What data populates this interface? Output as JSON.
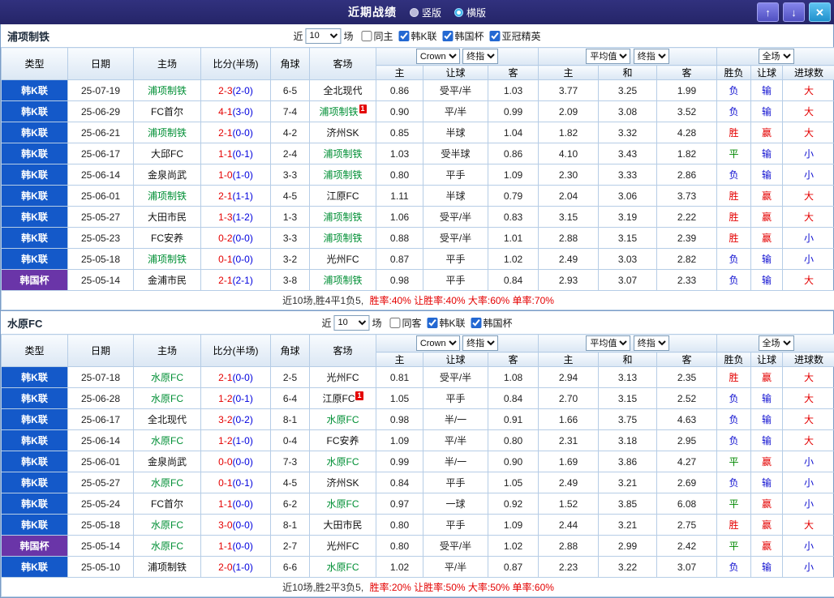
{
  "topbar": {
    "title": "近期战绩",
    "layout_options": [
      {
        "label": "竖版",
        "selected": false
      },
      {
        "label": "横版",
        "selected": true
      }
    ],
    "up_icon": "↑",
    "down_icon": "↓",
    "close_icon": "✕"
  },
  "colors": {
    "topbar_bg1": "#31317e",
    "topbar_bg2": "#252568",
    "up_btn1": "#8585ea",
    "up_btn2": "#5050c2",
    "close_btn1": "#5ec4f2",
    "close_btn2": "#2090cc",
    "header_bg1": "#f8fbfe",
    "header_bg2": "#dbe7f4",
    "border_outer": "#7a9cc6",
    "border_inner": "#b6cde6",
    "league_blue": "#1459c9",
    "cup_purple": "#6a35a8",
    "team_green": "#008f35",
    "score_red": "#e40000",
    "score_half_blue": "#0000dd",
    "win_red": "#e40000",
    "lose_blue": "#0f0fd0",
    "draw_green": "#008800",
    "summary_red": "#e40000"
  },
  "tables": [
    {
      "team": "浦项制铁",
      "filter": {
        "prefix": "近",
        "count": "10",
        "suffix": "场",
        "checkboxes": [
          {
            "label": "同主",
            "checked": false
          },
          {
            "label": "韩K联",
            "checked": true
          },
          {
            "label": "韩国杯",
            "checked": true
          },
          {
            "label": "亚冠精英",
            "checked": true
          }
        ]
      },
      "header": {
        "cols": [
          "类型",
          "日期",
          "主场",
          "比分(半场)",
          "角球",
          "客场"
        ],
        "selects": [
          "Crown",
          "终指",
          "平均值",
          "终指",
          "全场"
        ],
        "sub": [
          "主",
          "让球",
          "客",
          "主",
          "和",
          "客",
          "胜负",
          "让球",
          "进球数"
        ]
      },
      "rows": [
        {
          "type": "韩K联",
          "type_style": "kleague",
          "date": "25-07-19",
          "home": "浦项制铁",
          "home_focus": true,
          "home_badge": "",
          "score_full": "2-3",
          "score_half": "(2-0)",
          "corner": "6-5",
          "away": "全北现代",
          "away_focus": false,
          "away_badge": "",
          "odds_home": "0.86",
          "handicap": "受平/半",
          "odds_away": "1.03",
          "avg_home": "3.77",
          "avg_draw": "3.25",
          "avg_away": "1.99",
          "result": "负",
          "handicap_result": "输",
          "goals_result": "大"
        },
        {
          "type": "韩K联",
          "type_style": "kleague",
          "date": "25-06-29",
          "home": "FC首尔",
          "home_focus": false,
          "home_badge": "",
          "score_full": "4-1",
          "score_half": "(3-0)",
          "corner": "7-4",
          "away": "浦项制铁",
          "away_focus": true,
          "away_badge": "1",
          "odds_home": "0.90",
          "handicap": "平/半",
          "odds_away": "0.99",
          "avg_home": "2.09",
          "avg_draw": "3.08",
          "avg_away": "3.52",
          "result": "负",
          "handicap_result": "输",
          "goals_result": "大"
        },
        {
          "type": "韩K联",
          "type_style": "kleague",
          "date": "25-06-21",
          "home": "浦项制铁",
          "home_focus": true,
          "home_badge": "",
          "score_full": "2-1",
          "score_half": "(0-0)",
          "corner": "4-2",
          "away": "济州SK",
          "away_focus": false,
          "away_badge": "",
          "odds_home": "0.85",
          "handicap": "半球",
          "odds_away": "1.04",
          "avg_home": "1.82",
          "avg_draw": "3.32",
          "avg_away": "4.28",
          "result": "胜",
          "handicap_result": "赢",
          "goals_result": "大"
        },
        {
          "type": "韩K联",
          "type_style": "kleague",
          "date": "25-06-17",
          "home": "大邱FC",
          "home_focus": false,
          "home_badge": "",
          "score_full": "1-1",
          "score_half": "(0-1)",
          "corner": "2-4",
          "away": "浦项制铁",
          "away_focus": true,
          "away_badge": "",
          "odds_home": "1.03",
          "handicap": "受半球",
          "odds_away": "0.86",
          "avg_home": "4.10",
          "avg_draw": "3.43",
          "avg_away": "1.82",
          "result": "平",
          "handicap_result": "输",
          "goals_result": "小"
        },
        {
          "type": "韩K联",
          "type_style": "kleague",
          "date": "25-06-14",
          "home": "金泉尚武",
          "home_focus": false,
          "home_badge": "",
          "score_full": "1-0",
          "score_half": "(1-0)",
          "corner": "3-3",
          "away": "浦项制铁",
          "away_focus": true,
          "away_badge": "",
          "odds_home": "0.80",
          "handicap": "平手",
          "odds_away": "1.09",
          "avg_home": "2.30",
          "avg_draw": "3.33",
          "avg_away": "2.86",
          "result": "负",
          "handicap_result": "输",
          "goals_result": "小"
        },
        {
          "type": "韩K联",
          "type_style": "kleague",
          "date": "25-06-01",
          "home": "浦项制铁",
          "home_focus": true,
          "home_badge": "",
          "score_full": "2-1",
          "score_half": "(1-1)",
          "corner": "4-5",
          "away": "江原FC",
          "away_focus": false,
          "away_badge": "",
          "odds_home": "1.11",
          "handicap": "半球",
          "odds_away": "0.79",
          "avg_home": "2.04",
          "avg_draw": "3.06",
          "avg_away": "3.73",
          "result": "胜",
          "handicap_result": "赢",
          "goals_result": "大"
        },
        {
          "type": "韩K联",
          "type_style": "kleague",
          "date": "25-05-27",
          "home": "大田市民",
          "home_focus": false,
          "home_badge": "",
          "score_full": "1-3",
          "score_half": "(1-2)",
          "corner": "1-3",
          "away": "浦项制铁",
          "away_focus": true,
          "away_badge": "",
          "odds_home": "1.06",
          "handicap": "受平/半",
          "odds_away": "0.83",
          "avg_home": "3.15",
          "avg_draw": "3.19",
          "avg_away": "2.22",
          "result": "胜",
          "handicap_result": "赢",
          "goals_result": "大"
        },
        {
          "type": "韩K联",
          "type_style": "kleague",
          "date": "25-05-23",
          "home": "FC安养",
          "home_focus": false,
          "home_badge": "",
          "score_full": "0-2",
          "score_half": "(0-0)",
          "corner": "3-3",
          "away": "浦项制铁",
          "away_focus": true,
          "away_badge": "",
          "odds_home": "0.88",
          "handicap": "受平/半",
          "odds_away": "1.01",
          "avg_home": "2.88",
          "avg_draw": "3.15",
          "avg_away": "2.39",
          "result": "胜",
          "handicap_result": "赢",
          "goals_result": "小"
        },
        {
          "type": "韩K联",
          "type_style": "kleague",
          "date": "25-05-18",
          "home": "浦项制铁",
          "home_focus": true,
          "home_badge": "",
          "score_full": "0-1",
          "score_half": "(0-0)",
          "corner": "3-2",
          "away": "光州FC",
          "away_focus": false,
          "away_badge": "",
          "odds_home": "0.87",
          "handicap": "平手",
          "odds_away": "1.02",
          "avg_home": "2.49",
          "avg_draw": "3.03",
          "avg_away": "2.82",
          "result": "负",
          "handicap_result": "输",
          "goals_result": "小"
        },
        {
          "type": "韩国杯",
          "type_style": "cup",
          "date": "25-05-14",
          "home": "金浦市民",
          "home_focus": false,
          "home_badge": "",
          "score_full": "2-1",
          "score_half": "(2-1)",
          "corner": "3-8",
          "away": "浦项制铁",
          "away_focus": true,
          "away_badge": "",
          "odds_home": "0.98",
          "handicap": "平手",
          "odds_away": "0.84",
          "avg_home": "2.93",
          "avg_draw": "3.07",
          "avg_away": "2.33",
          "result": "负",
          "handicap_result": "输",
          "goals_result": "大"
        }
      ],
      "summary": {
        "prefix": "近10场,胜4平1负5,",
        "rates": "胜率:40% 让胜率:40% 大率:60% 单率:70%"
      }
    },
    {
      "team": "水原FC",
      "filter": {
        "prefix": "近",
        "count": "10",
        "suffix": "场",
        "checkboxes": [
          {
            "label": "同客",
            "checked": false
          },
          {
            "label": "韩K联",
            "checked": true
          },
          {
            "label": "韩国杯",
            "checked": true
          }
        ]
      },
      "header": {
        "cols": [
          "类型",
          "日期",
          "主场",
          "比分(半场)",
          "角球",
          "客场"
        ],
        "selects": [
          "Crown",
          "终指",
          "平均值",
          "终指",
          "全场"
        ],
        "sub": [
          "主",
          "让球",
          "客",
          "主",
          "和",
          "客",
          "胜负",
          "让球",
          "进球数"
        ]
      },
      "rows": [
        {
          "type": "韩K联",
          "type_style": "kleague",
          "date": "25-07-18",
          "home": "水原FC",
          "home_focus": true,
          "home_badge": "",
          "score_full": "2-1",
          "score_half": "(0-0)",
          "corner": "2-5",
          "away": "光州FC",
          "away_focus": false,
          "away_badge": "",
          "odds_home": "0.81",
          "handicap": "受平/半",
          "odds_away": "1.08",
          "avg_home": "2.94",
          "avg_draw": "3.13",
          "avg_away": "2.35",
          "result": "胜",
          "handicap_result": "赢",
          "goals_result": "大"
        },
        {
          "type": "韩K联",
          "type_style": "kleague",
          "date": "25-06-28",
          "home": "水原FC",
          "home_focus": true,
          "home_badge": "",
          "score_full": "1-2",
          "score_half": "(0-1)",
          "corner": "6-4",
          "away": "江原FC",
          "away_focus": false,
          "away_badge": "1",
          "odds_home": "1.05",
          "handicap": "平手",
          "odds_away": "0.84",
          "avg_home": "2.70",
          "avg_draw": "3.15",
          "avg_away": "2.52",
          "result": "负",
          "handicap_result": "输",
          "goals_result": "大"
        },
        {
          "type": "韩K联",
          "type_style": "kleague",
          "date": "25-06-17",
          "home": "全北现代",
          "home_focus": false,
          "home_badge": "",
          "score_full": "3-2",
          "score_half": "(0-2)",
          "corner": "8-1",
          "away": "水原FC",
          "away_focus": true,
          "away_badge": "",
          "odds_home": "0.98",
          "handicap": "半/一",
          "odds_away": "0.91",
          "avg_home": "1.66",
          "avg_draw": "3.75",
          "avg_away": "4.63",
          "result": "负",
          "handicap_result": "输",
          "goals_result": "大"
        },
        {
          "type": "韩K联",
          "type_style": "kleague",
          "date": "25-06-14",
          "home": "水原FC",
          "home_focus": true,
          "home_badge": "",
          "score_full": "1-2",
          "score_half": "(1-0)",
          "corner": "0-4",
          "away": "FC安养",
          "away_focus": false,
          "away_badge": "",
          "odds_home": "1.09",
          "handicap": "平/半",
          "odds_away": "0.80",
          "avg_home": "2.31",
          "avg_draw": "3.18",
          "avg_away": "2.95",
          "result": "负",
          "handicap_result": "输",
          "goals_result": "大"
        },
        {
          "type": "韩K联",
          "type_style": "kleague",
          "date": "25-06-01",
          "home": "金泉尚武",
          "home_focus": false,
          "home_badge": "",
          "score_full": "0-0",
          "score_half": "(0-0)",
          "corner": "7-3",
          "away": "水原FC",
          "away_focus": true,
          "away_badge": "",
          "odds_home": "0.99",
          "handicap": "半/一",
          "odds_away": "0.90",
          "avg_home": "1.69",
          "avg_draw": "3.86",
          "avg_away": "4.27",
          "result": "平",
          "handicap_result": "赢",
          "goals_result": "小"
        },
        {
          "type": "韩K联",
          "type_style": "kleague",
          "date": "25-05-27",
          "home": "水原FC",
          "home_focus": true,
          "home_badge": "",
          "score_full": "0-1",
          "score_half": "(0-1)",
          "corner": "4-5",
          "away": "济州SK",
          "away_focus": false,
          "away_badge": "",
          "odds_home": "0.84",
          "handicap": "平手",
          "odds_away": "1.05",
          "avg_home": "2.49",
          "avg_draw": "3.21",
          "avg_away": "2.69",
          "result": "负",
          "handicap_result": "输",
          "goals_result": "小"
        },
        {
          "type": "韩K联",
          "type_style": "kleague",
          "date": "25-05-24",
          "home": "FC首尔",
          "home_focus": false,
          "home_badge": "",
          "score_full": "1-1",
          "score_half": "(0-0)",
          "corner": "6-2",
          "away": "水原FC",
          "away_focus": true,
          "away_badge": "",
          "odds_home": "0.97",
          "handicap": "一球",
          "odds_away": "0.92",
          "avg_home": "1.52",
          "avg_draw": "3.85",
          "avg_away": "6.08",
          "result": "平",
          "handicap_result": "赢",
          "goals_result": "小"
        },
        {
          "type": "韩K联",
          "type_style": "kleague",
          "date": "25-05-18",
          "home": "水原FC",
          "home_focus": true,
          "home_badge": "",
          "score_full": "3-0",
          "score_half": "(0-0)",
          "corner": "8-1",
          "away": "大田市民",
          "away_focus": false,
          "away_badge": "",
          "odds_home": "0.80",
          "handicap": "平手",
          "odds_away": "1.09",
          "avg_home": "2.44",
          "avg_draw": "3.21",
          "avg_away": "2.75",
          "result": "胜",
          "handicap_result": "赢",
          "goals_result": "大"
        },
        {
          "type": "韩国杯",
          "type_style": "cup",
          "date": "25-05-14",
          "home": "水原FC",
          "home_focus": true,
          "home_badge": "",
          "score_full": "1-1",
          "score_half": "(0-0)",
          "corner": "2-7",
          "away": "光州FC",
          "away_focus": false,
          "away_badge": "",
          "odds_home": "0.80",
          "handicap": "受平/半",
          "odds_away": "1.02",
          "avg_home": "2.88",
          "avg_draw": "2.99",
          "avg_away": "2.42",
          "result": "平",
          "handicap_result": "赢",
          "goals_result": "小"
        },
        {
          "type": "韩K联",
          "type_style": "kleague",
          "date": "25-05-10",
          "home": "浦项制铁",
          "home_focus": false,
          "home_badge": "",
          "score_full": "2-0",
          "score_half": "(1-0)",
          "corner": "6-6",
          "away": "水原FC",
          "away_focus": true,
          "away_badge": "",
          "odds_home": "1.02",
          "handicap": "平/半",
          "odds_away": "0.87",
          "avg_home": "2.23",
          "avg_draw": "3.22",
          "avg_away": "3.07",
          "result": "负",
          "handicap_result": "输",
          "goals_result": "小"
        }
      ],
      "summary": {
        "prefix": "近10场,胜2平3负5,",
        "rates": "胜率:20% 让胜率:50% 大率:50% 单率:60%"
      }
    }
  ]
}
